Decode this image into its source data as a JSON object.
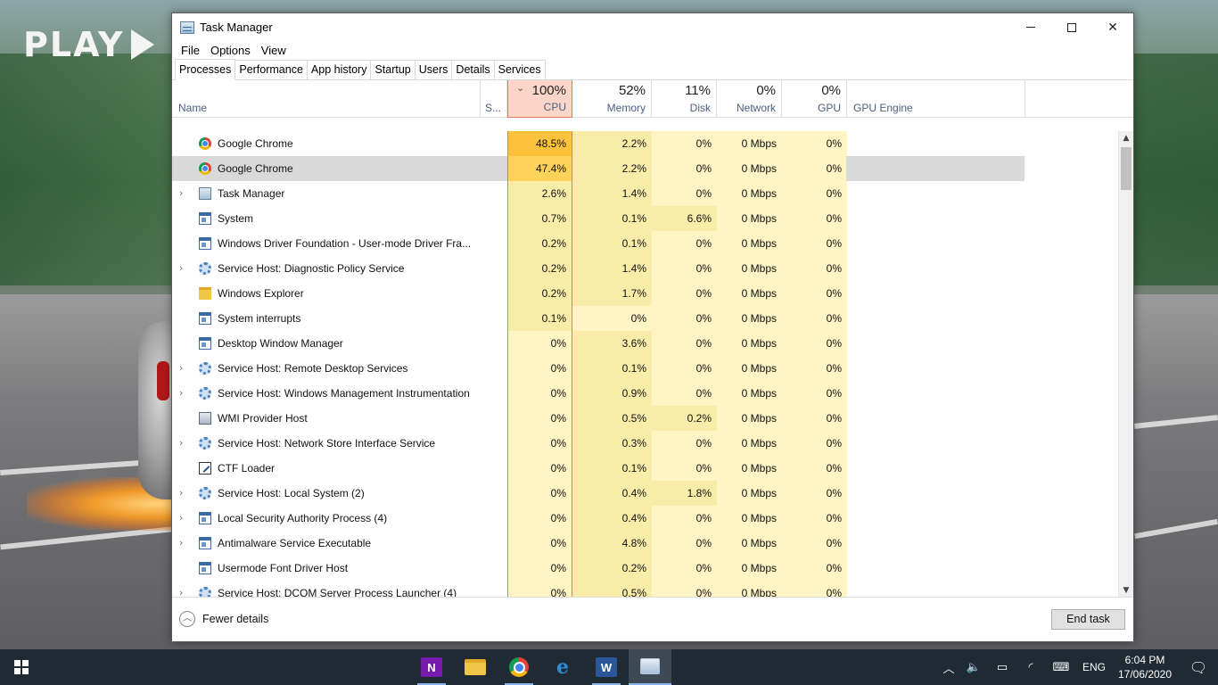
{
  "desktop": {
    "logo_text": "PLAY"
  },
  "window": {
    "title": "Task Manager",
    "controls": {
      "minimize": "—",
      "maximize": "☐",
      "close": "✕"
    }
  },
  "menu": [
    "File",
    "Options",
    "View"
  ],
  "tabs": [
    "Processes",
    "Performance",
    "App history",
    "Startup",
    "Users",
    "Details",
    "Services"
  ],
  "active_tab": "Processes",
  "columns": {
    "name": "Name",
    "status": "S...",
    "cpu": {
      "pct": "100%",
      "label": "CPU"
    },
    "memory": {
      "pct": "52%",
      "label": "Memory"
    },
    "disk": {
      "pct": "11%",
      "label": "Disk"
    },
    "network": {
      "pct": "0%",
      "label": "Network"
    },
    "gpu": {
      "pct": "0%",
      "label": "GPU"
    },
    "gpu_engine": "GPU Engine"
  },
  "processes": [
    {
      "name": "Google Chrome",
      "icon": "chrome-icon",
      "expandable": false,
      "cpu": "48.5%",
      "memory": "2.2%",
      "disk": "0%",
      "network": "0 Mbps",
      "gpu": "0%",
      "selected": false
    },
    {
      "name": "Google Chrome",
      "icon": "chrome-icon",
      "expandable": false,
      "cpu": "47.4%",
      "memory": "2.2%",
      "disk": "0%",
      "network": "0 Mbps",
      "gpu": "0%",
      "selected": true
    },
    {
      "name": "Task Manager",
      "icon": "task-manager-icon",
      "expandable": true,
      "cpu": "2.6%",
      "memory": "1.4%",
      "disk": "0%",
      "network": "0 Mbps",
      "gpu": "0%",
      "selected": false
    },
    {
      "name": "System",
      "icon": "window-icon",
      "expandable": false,
      "cpu": "0.7%",
      "memory": "0.1%",
      "disk": "6.6%",
      "network": "0 Mbps",
      "gpu": "0%",
      "selected": false
    },
    {
      "name": "Windows Driver Foundation - User-mode Driver Fra...",
      "icon": "window-icon",
      "expandable": false,
      "cpu": "0.2%",
      "memory": "0.1%",
      "disk": "0%",
      "network": "0 Mbps",
      "gpu": "0%",
      "selected": false
    },
    {
      "name": "Service Host: Diagnostic Policy Service",
      "icon": "gear-icon",
      "expandable": true,
      "cpu": "0.2%",
      "memory": "1.4%",
      "disk": "0%",
      "network": "0 Mbps",
      "gpu": "0%",
      "selected": false
    },
    {
      "name": "Windows Explorer",
      "icon": "folder-icon",
      "expandable": false,
      "cpu": "0.2%",
      "memory": "1.7%",
      "disk": "0%",
      "network": "0 Mbps",
      "gpu": "0%",
      "selected": false
    },
    {
      "name": "System interrupts",
      "icon": "window-icon",
      "expandable": false,
      "cpu": "0.1%",
      "memory": "0%",
      "disk": "0%",
      "network": "0 Mbps",
      "gpu": "0%",
      "selected": false
    },
    {
      "name": "Desktop Window Manager",
      "icon": "window-icon",
      "expandable": false,
      "cpu": "0%",
      "memory": "3.6%",
      "disk": "0%",
      "network": "0 Mbps",
      "gpu": "0%",
      "selected": false
    },
    {
      "name": "Service Host: Remote Desktop Services",
      "icon": "gear-icon",
      "expandable": true,
      "cpu": "0%",
      "memory": "0.1%",
      "disk": "0%",
      "network": "0 Mbps",
      "gpu": "0%",
      "selected": false
    },
    {
      "name": "Service Host: Windows Management Instrumentation",
      "icon": "gear-icon",
      "expandable": true,
      "cpu": "0%",
      "memory": "0.9%",
      "disk": "0%",
      "network": "0 Mbps",
      "gpu": "0%",
      "selected": false
    },
    {
      "name": "WMI Provider Host",
      "icon": "wmi-icon",
      "expandable": false,
      "cpu": "0%",
      "memory": "0.5%",
      "disk": "0.2%",
      "network": "0 Mbps",
      "gpu": "0%",
      "selected": false
    },
    {
      "name": "Service Host: Network Store Interface Service",
      "icon": "gear-icon",
      "expandable": true,
      "cpu": "0%",
      "memory": "0.3%",
      "disk": "0%",
      "network": "0 Mbps",
      "gpu": "0%",
      "selected": false
    },
    {
      "name": "CTF Loader",
      "icon": "ctf-icon",
      "expandable": false,
      "cpu": "0%",
      "memory": "0.1%",
      "disk": "0%",
      "network": "0 Mbps",
      "gpu": "0%",
      "selected": false
    },
    {
      "name": "Service Host: Local System (2)",
      "icon": "gear-icon",
      "expandable": true,
      "cpu": "0%",
      "memory": "0.4%",
      "disk": "1.8%",
      "network": "0 Mbps",
      "gpu": "0%",
      "selected": false
    },
    {
      "name": "Local Security Authority Process (4)",
      "icon": "window-icon",
      "expandable": true,
      "cpu": "0%",
      "memory": "0.4%",
      "disk": "0%",
      "network": "0 Mbps",
      "gpu": "0%",
      "selected": false
    },
    {
      "name": "Antimalware Service Executable",
      "icon": "window-icon",
      "expandable": true,
      "cpu": "0%",
      "memory": "4.8%",
      "disk": "0%",
      "network": "0 Mbps",
      "gpu": "0%",
      "selected": false
    },
    {
      "name": "Usermode Font Driver Host",
      "icon": "window-icon",
      "expandable": false,
      "cpu": "0%",
      "memory": "0.2%",
      "disk": "0%",
      "network": "0 Mbps",
      "gpu": "0%",
      "selected": false
    },
    {
      "name": "Service Host: DCOM Server Process Launcher (4)",
      "icon": "gear-icon",
      "expandable": true,
      "cpu": "0%",
      "memory": "0.5%",
      "disk": "0%",
      "network": "0 Mbps",
      "gpu": "0%",
      "selected": false
    }
  ],
  "footer": {
    "fewer_details": "Fewer details",
    "end_task": "End task"
  },
  "taskbar": {
    "apps": [
      "onenote-icon",
      "file-explorer-icon",
      "chrome-icon",
      "edge-icon",
      "word-icon",
      "task-manager-icon"
    ],
    "tray": {
      "language": "ENG",
      "time": "6:04 PM",
      "date": "17/06/2020"
    }
  },
  "colors": {
    "cpu_header": "#fbd6c8",
    "cpu_border": "#e8795d",
    "heat_0": "#fff4c4",
    "heat_1": "#f9eca8",
    "heat_2": "#ffd35a",
    "heat_3": "#fcc23c",
    "selected_row": "#d9d9d9",
    "taskbar": "#1f2a33"
  }
}
